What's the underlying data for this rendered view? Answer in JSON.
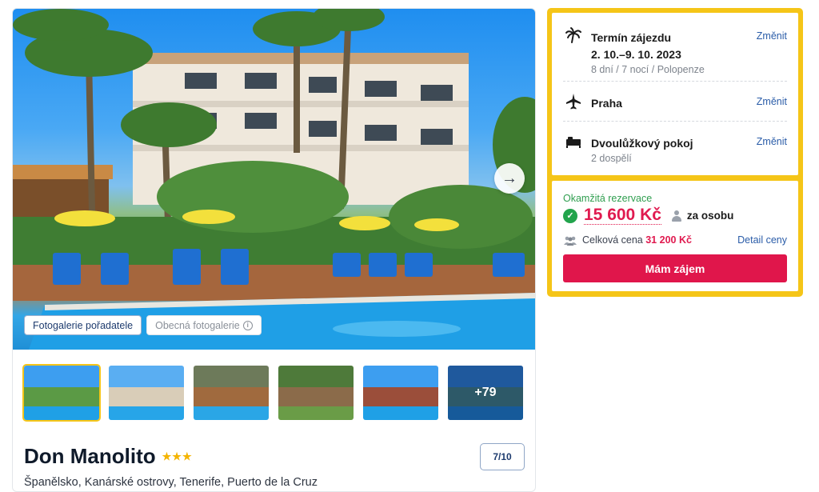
{
  "gallery": {
    "tabs": [
      {
        "label": "Fotogalerie pořadatele"
      },
      {
        "label": "Obecná fotogalerie"
      }
    ],
    "next_arrow": "→",
    "more_count": "+79"
  },
  "hotel": {
    "name": "Don Manolito",
    "stars": "★★★",
    "rating": "7/10",
    "location": "Španělsko, Kanárské ostrovy, Tenerife, Puerto de la Cruz"
  },
  "booking": {
    "term": {
      "title": "Termín zájezdu",
      "dates": "2. 10.–9. 10. 2023",
      "detail": "8 dní / 7 nocí / Polopenze",
      "change": "Změnit",
      "icon": "palm-tree-icon"
    },
    "departure": {
      "title": "Praha",
      "change": "Změnit",
      "icon": "airplane-icon"
    },
    "room": {
      "title": "Dvoulůžkový pokoj",
      "detail": "2 dospělí",
      "change": "Změnit",
      "icon": "bed-icon"
    }
  },
  "price": {
    "instant_label": "Okamžitá rezervace",
    "amount": "15 600 Kč",
    "per_person": "za osobu",
    "total_label": "Celková cena",
    "total_value": "31 200 Kč",
    "detail_link": "Detail ceny",
    "cta": "Mám zájem"
  },
  "colors": {
    "accent_yellow": "#f5c518",
    "price_red": "#e01a4f",
    "link_blue": "#2a5ca8",
    "success_green": "#22a44c"
  }
}
